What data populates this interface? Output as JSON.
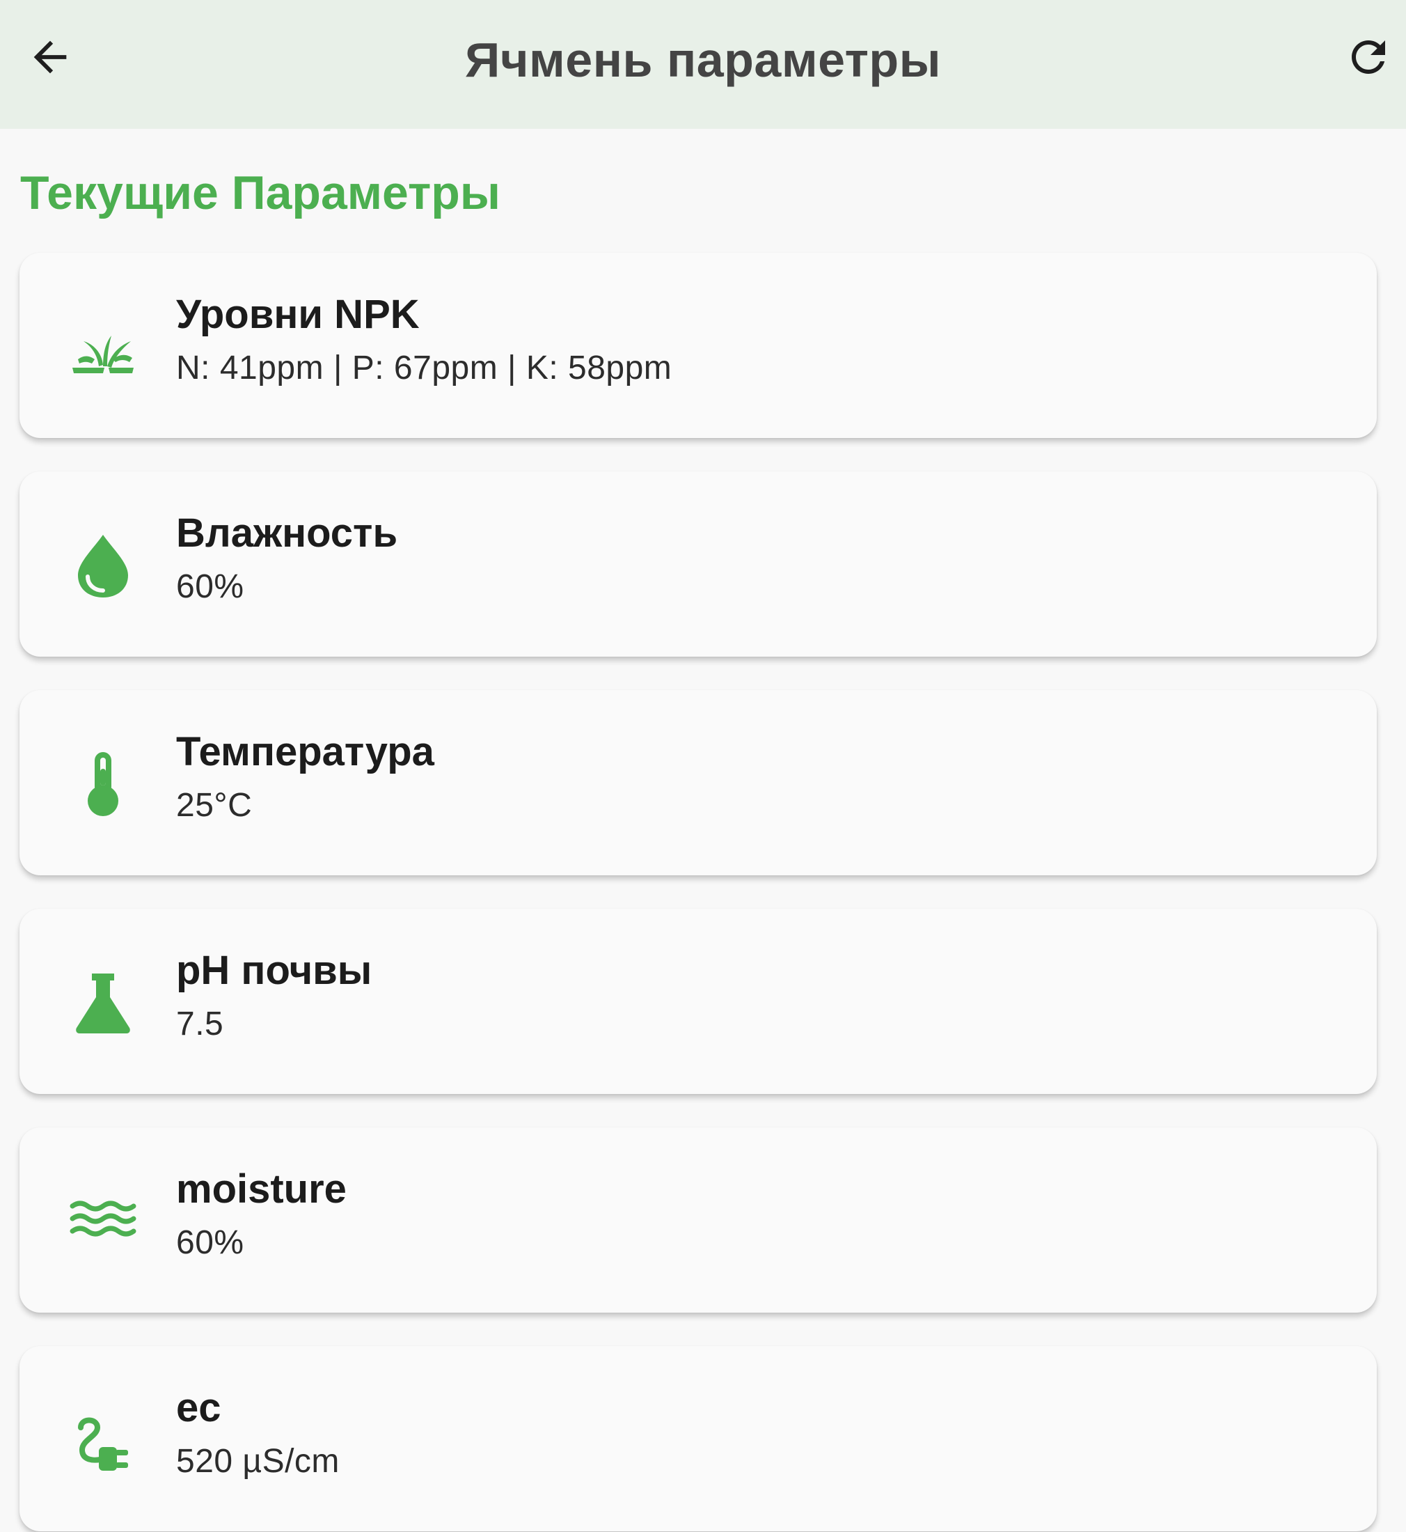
{
  "app_bar": {
    "title": "Ячмень параметры",
    "back_icon": "arrow-back-icon",
    "refresh_icon": "refresh-icon"
  },
  "section": {
    "title": "Текущие Параметры"
  },
  "accent_color": "#4caf50",
  "cards": [
    {
      "label": "Уровни NPK",
      "value": "N: 41ppm | P: 67ppm | K: 58ppm",
      "icon": "grass-icon"
    },
    {
      "label": "Влажность",
      "value": "60%",
      "icon": "water-drop-icon"
    },
    {
      "label": "Температура",
      "value": "25°C",
      "icon": "thermometer-icon"
    },
    {
      "label": "pH почвы",
      "value": "7.5",
      "icon": "flask-icon"
    },
    {
      "label": "moisture",
      "value": "60%",
      "icon": "waves-icon"
    },
    {
      "label": "ec",
      "value": "520 µS/cm",
      "icon": "electrical-plug-icon"
    }
  ]
}
